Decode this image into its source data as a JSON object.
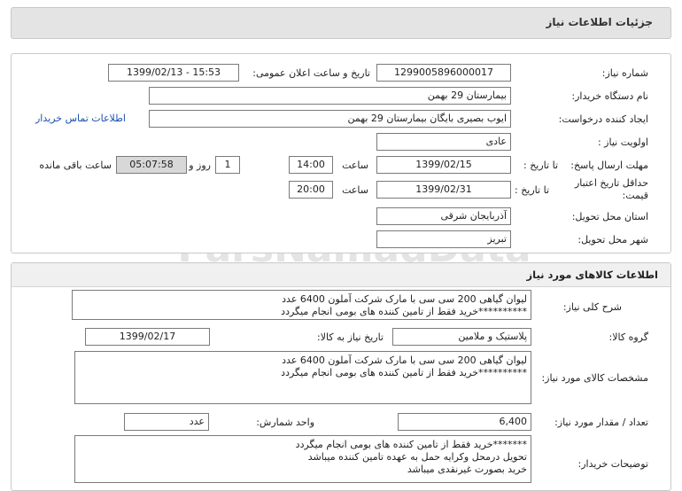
{
  "header": {
    "title": "جزئیات اطلاعات نیاز"
  },
  "need": {
    "number_label": "شماره نیاز:",
    "number": "1299005896000017",
    "announce_label": "تاریخ و ساعت اعلان عمومی:",
    "announce": "1399/02/13 - 15:53",
    "buyer_label": "نام دستگاه خریدار:",
    "buyer": "بیمارستان 29 بهمن",
    "creator_label": "ایجاد کننده درخواست:",
    "creator": "ایوب بصیری  بایگان بیمارستان 29 بهمن",
    "contact_link": "اطلاعات تماس خریدار",
    "priority_label": "اولویت نیاز :",
    "priority": "عادی",
    "deadline_label": "مهلت ارسال پاسخ:",
    "deadline_to": "تا تاریخ :",
    "deadline_date": "1399/02/15",
    "deadline_time_label": "ساعت",
    "deadline_time": "14:00",
    "days": "1",
    "days_label": "روز و",
    "remaining": "05:07:58",
    "remaining_label": "ساعت باقی مانده",
    "validity_label_1": "حداقل تاریخ اعتبار",
    "validity_label_2": "قیمت:",
    "validity_to": "تا تاریخ :",
    "validity_date": "1399/02/31",
    "validity_time_label": "ساعت",
    "validity_time": "20:00",
    "province_label": "استان محل تحویل:",
    "province": "آذربایجان شرقی",
    "city_label": "شهر محل تحویل:",
    "city": "تبریز"
  },
  "goods": {
    "section_title": "اطلاعات کالاهای مورد نیاز",
    "desc_label": "شرح کلی نیاز:",
    "desc_lines": [
      "لیوان گیاهی 200 سی سی با مارک شرکت آملون 6400 عدد",
      "**********خرید فقط از تامین کننده های بومی انجام میگردد"
    ],
    "group_label": "گروه کالا:",
    "group": "پلاستیک و ملامین",
    "need_date_label": "تاریخ نیاز به کالا:",
    "need_date": "1399/02/17",
    "spec_label": "مشخصات کالای مورد نیاز:",
    "spec_lines": [
      "لیوان گیاهی 200 سی سی با مارک شرکت آملون 6400 عدد",
      "**********خرید فقط از تامین کننده های بومی انجام میگردد"
    ],
    "qty_label": "تعداد / مقدار مورد نیاز:",
    "qty": "6,400",
    "unit_label": "واحد شمارش:",
    "unit": "عدد",
    "notes_label": "توضیحات خریدار:",
    "notes_lines": [
      "*******خرید فقط از تامین کننده های بومی انجام میگردد",
      "تحویل درمحل وکرایه حمل به عهده تامین کننده میباشد",
      "خرید بصورت غیرنقدی میباشد"
    ]
  },
  "watermark": {
    "text": "ParsNamadData"
  }
}
